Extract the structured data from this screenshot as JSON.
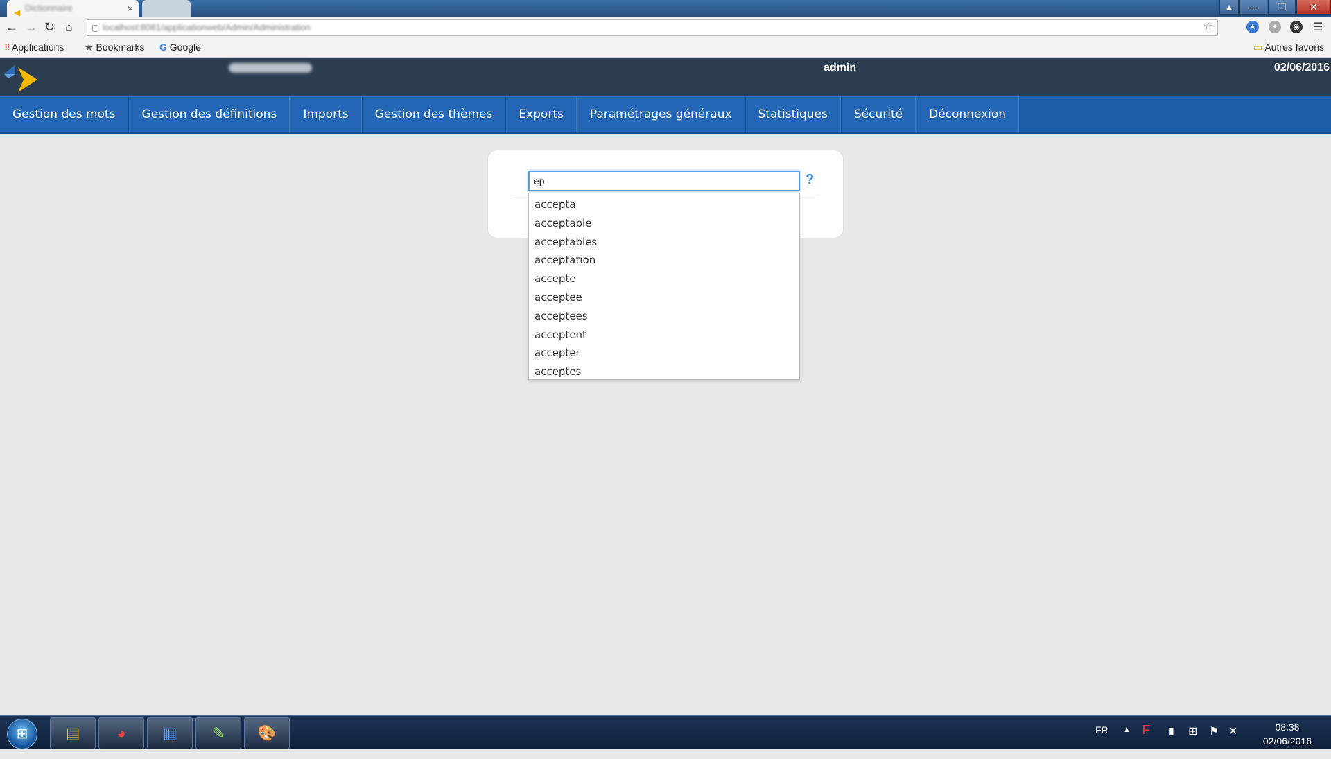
{
  "browser": {
    "active_tab_title": "Dictionnaire",
    "tab_close": "×",
    "address": "localhost:8081/applicationweb/Admin/Administration",
    "bookmarks": [
      {
        "label": "Applications",
        "icon": "apps-grid-icon"
      },
      {
        "label": "Bookmarks",
        "icon": "star-icon"
      },
      {
        "label": "Google",
        "icon": "google-icon"
      }
    ],
    "other_bookmarks": "Autres favoris"
  },
  "header": {
    "user": "admin",
    "date": "02/06/2016"
  },
  "nav": {
    "items": [
      "Gestion des mots",
      "Gestion des définitions",
      "Imports",
      "Gestion des thèmes",
      "Exports",
      "Paramétrages généraux",
      "Statistiques",
      "Sécurité",
      "Déconnexion"
    ]
  },
  "search": {
    "value": "ep",
    "help": "?",
    "suggestions": [
      "accepta",
      "acceptable",
      "acceptables",
      "acceptation",
      "accepte",
      "acceptee",
      "acceptees",
      "acceptent",
      "accepter",
      "acceptes"
    ]
  },
  "taskbar": {
    "language": "FR",
    "time": "08:38",
    "date": "02/06/2016"
  },
  "colors": {
    "header_bg": "#2c3e50",
    "nav_bg": "#2266b5",
    "page_bg": "#e7e7e7",
    "accent": "#3a86c8"
  }
}
